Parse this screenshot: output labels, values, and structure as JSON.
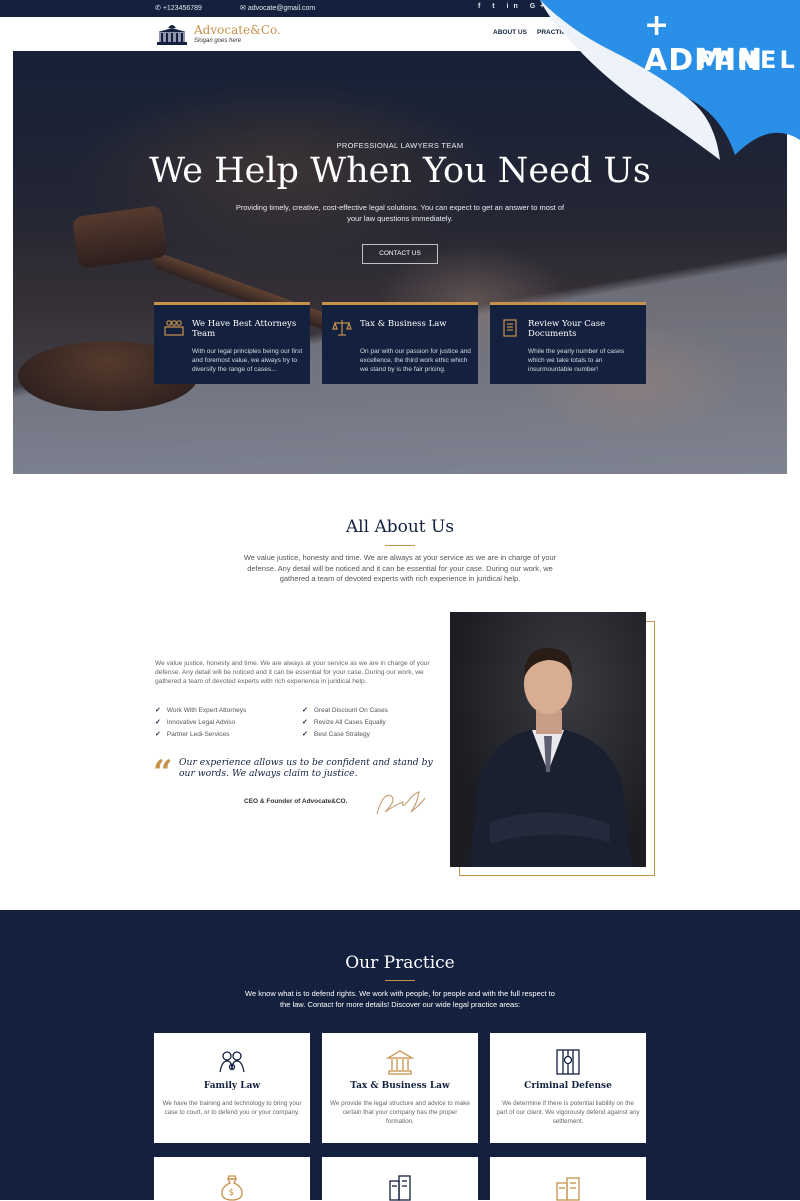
{
  "topbar": {
    "phone": "+123456789",
    "email": "advocate@gmail.com",
    "social_icons": [
      "facebook-icon",
      "twitter-icon",
      "linkedin-icon",
      "google-plus-icon"
    ],
    "social_glyphs": "f t in G+"
  },
  "header": {
    "logo_title": "Advocate&Co.",
    "logo_slogan": "Slogan goes here",
    "nav": [
      "ABOUT US",
      "PRACTICE"
    ]
  },
  "ribbon": {
    "line1": "+ ADMIN",
    "line2": "PANEL",
    "color": "#2a8fe6"
  },
  "hero": {
    "eyebrow": "PROFESSIONAL LAWYERS TEAM",
    "title": "We Help When You Need Us",
    "subtitle": "Providing timely, creative, cost-effective legal solutions. You can expect to get an answer to most of your law questions immediately.",
    "cta": "CONTACT US",
    "cards": [
      {
        "icon": "attorneys-icon",
        "title": "We Have Best Attorneys Team",
        "text": "With our legal principles being our first and foremost value, we always try to diversify the range of cases..."
      },
      {
        "icon": "scales-icon",
        "title": "Tax & Business Law",
        "text": "On par with our passion for justice and excellence, the third work ethic which we stand by is the fair pricing."
      },
      {
        "icon": "document-icon",
        "title": "Review Your Case Documents",
        "text": "While the yearly number of cases which we take totals to an insurmountable number!"
      }
    ]
  },
  "about": {
    "title": "All About Us",
    "intro": "We value justice, honesty and time. We are always at your service as we are in charge of your defense. Any detail will be noticed and it can be essential for your case. During our work, we gathered a team of devoted experts with rich experience in juridical help.",
    "body": "We value justice, honesty and time. We are always at your service as we are in charge of your defense. Any detail will be noticed and it can be essential for your case. During our work, we gathered a team of devoted experts with rich experience in juridical help.",
    "checks_left": [
      "Work With Expert Attorneys",
      "Innovative Legal Adviso",
      "Partner Ledi-Services"
    ],
    "checks_right": [
      "Great Discount On Cases",
      "Revize All Cases Equally",
      "Best Case Strategy"
    ],
    "quote": "Our experience allows us to be confident and stand by our words. We always claim to justice.",
    "ceo": "CEO & Founder of Advocate&CO.",
    "signature": "D. Ay"
  },
  "practice": {
    "title": "Our Practice",
    "intro": "We know what is to defend rights. We work with people, for people and with the full respect to the law. Contact for more details! Discover our wide legal practice areas:",
    "cards": [
      {
        "icon": "family-icon",
        "title": "Family Law",
        "text": "We have the training and technology to bring your case to court, or to defend you or your company."
      },
      {
        "icon": "bank-icon",
        "title": "Tax & Business Law",
        "text": "We provide the legal structure and advice to make certain that your company has the proper formation."
      },
      {
        "icon": "prison-icon",
        "title": "Criminal Defense",
        "text": "We determine if there is potential liability on the part of our client. We vigorously defend against any settlement."
      }
    ],
    "more_icons": [
      "money-bag-icon",
      "buildings-icon",
      "real-estate-icon"
    ]
  },
  "colors": {
    "navy": "#13213f",
    "gold": "#c7924b"
  }
}
